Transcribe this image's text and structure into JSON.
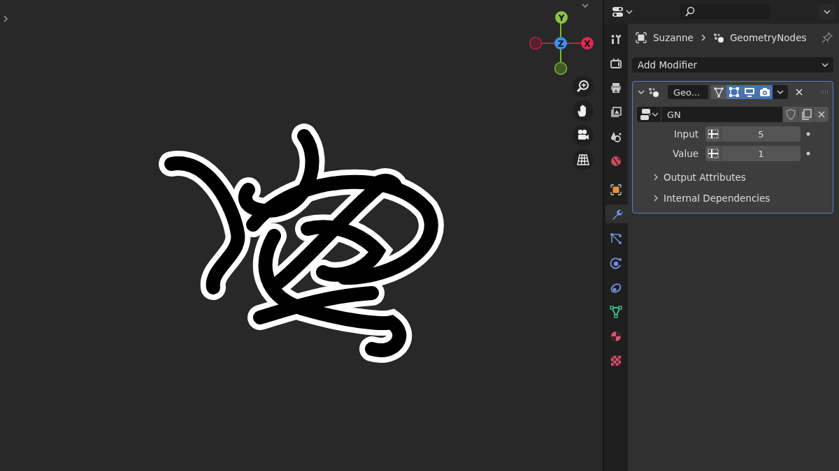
{
  "viewport": {
    "gizmo": {
      "axes": [
        {
          "label": "Y",
          "kind": "y"
        },
        {
          "label": "Z",
          "kind": "z"
        },
        {
          "label": "X",
          "kind": "x"
        }
      ]
    },
    "nav_buttons": [
      {
        "kind": "zoom"
      },
      {
        "kind": "pan"
      },
      {
        "kind": "camera"
      },
      {
        "kind": "ortho"
      }
    ]
  },
  "properties": {
    "tabs": [
      {
        "kind": "tool",
        "selected": false
      },
      {
        "kind": "render",
        "selected": false
      },
      {
        "kind": "output",
        "selected": false
      },
      {
        "kind": "view_layer",
        "selected": false
      },
      {
        "kind": "scene",
        "selected": false
      },
      {
        "kind": "world",
        "selected": false
      },
      {
        "kind": "object",
        "selected": false
      },
      {
        "kind": "modifiers",
        "selected": true
      },
      {
        "kind": "particles",
        "selected": false
      },
      {
        "kind": "physics",
        "selected": false
      },
      {
        "kind": "constraints",
        "selected": false
      },
      {
        "kind": "data",
        "selected": false
      },
      {
        "kind": "material",
        "selected": false
      },
      {
        "kind": "texture",
        "selected": false
      }
    ],
    "breadcrumb": {
      "object": "Suzanne",
      "modifier": "GeometryNodes"
    },
    "add_modifier": "Add Modifier",
    "modifier": {
      "name": "Geo...",
      "expanded": true,
      "toggles": [
        {
          "kind": "on_cage",
          "on": false
        },
        {
          "kind": "edit_mode",
          "on": true
        },
        {
          "kind": "viewport",
          "on": true
        },
        {
          "kind": "render",
          "on": true
        }
      ],
      "node_group": "GN",
      "inputs": [
        {
          "label": "Input",
          "value": "5"
        },
        {
          "label": "Value",
          "value": "1"
        }
      ],
      "subpanels": [
        {
          "label": "Output Attributes",
          "expanded": false
        },
        {
          "label": "Internal Dependencies",
          "expanded": false
        }
      ]
    }
  }
}
